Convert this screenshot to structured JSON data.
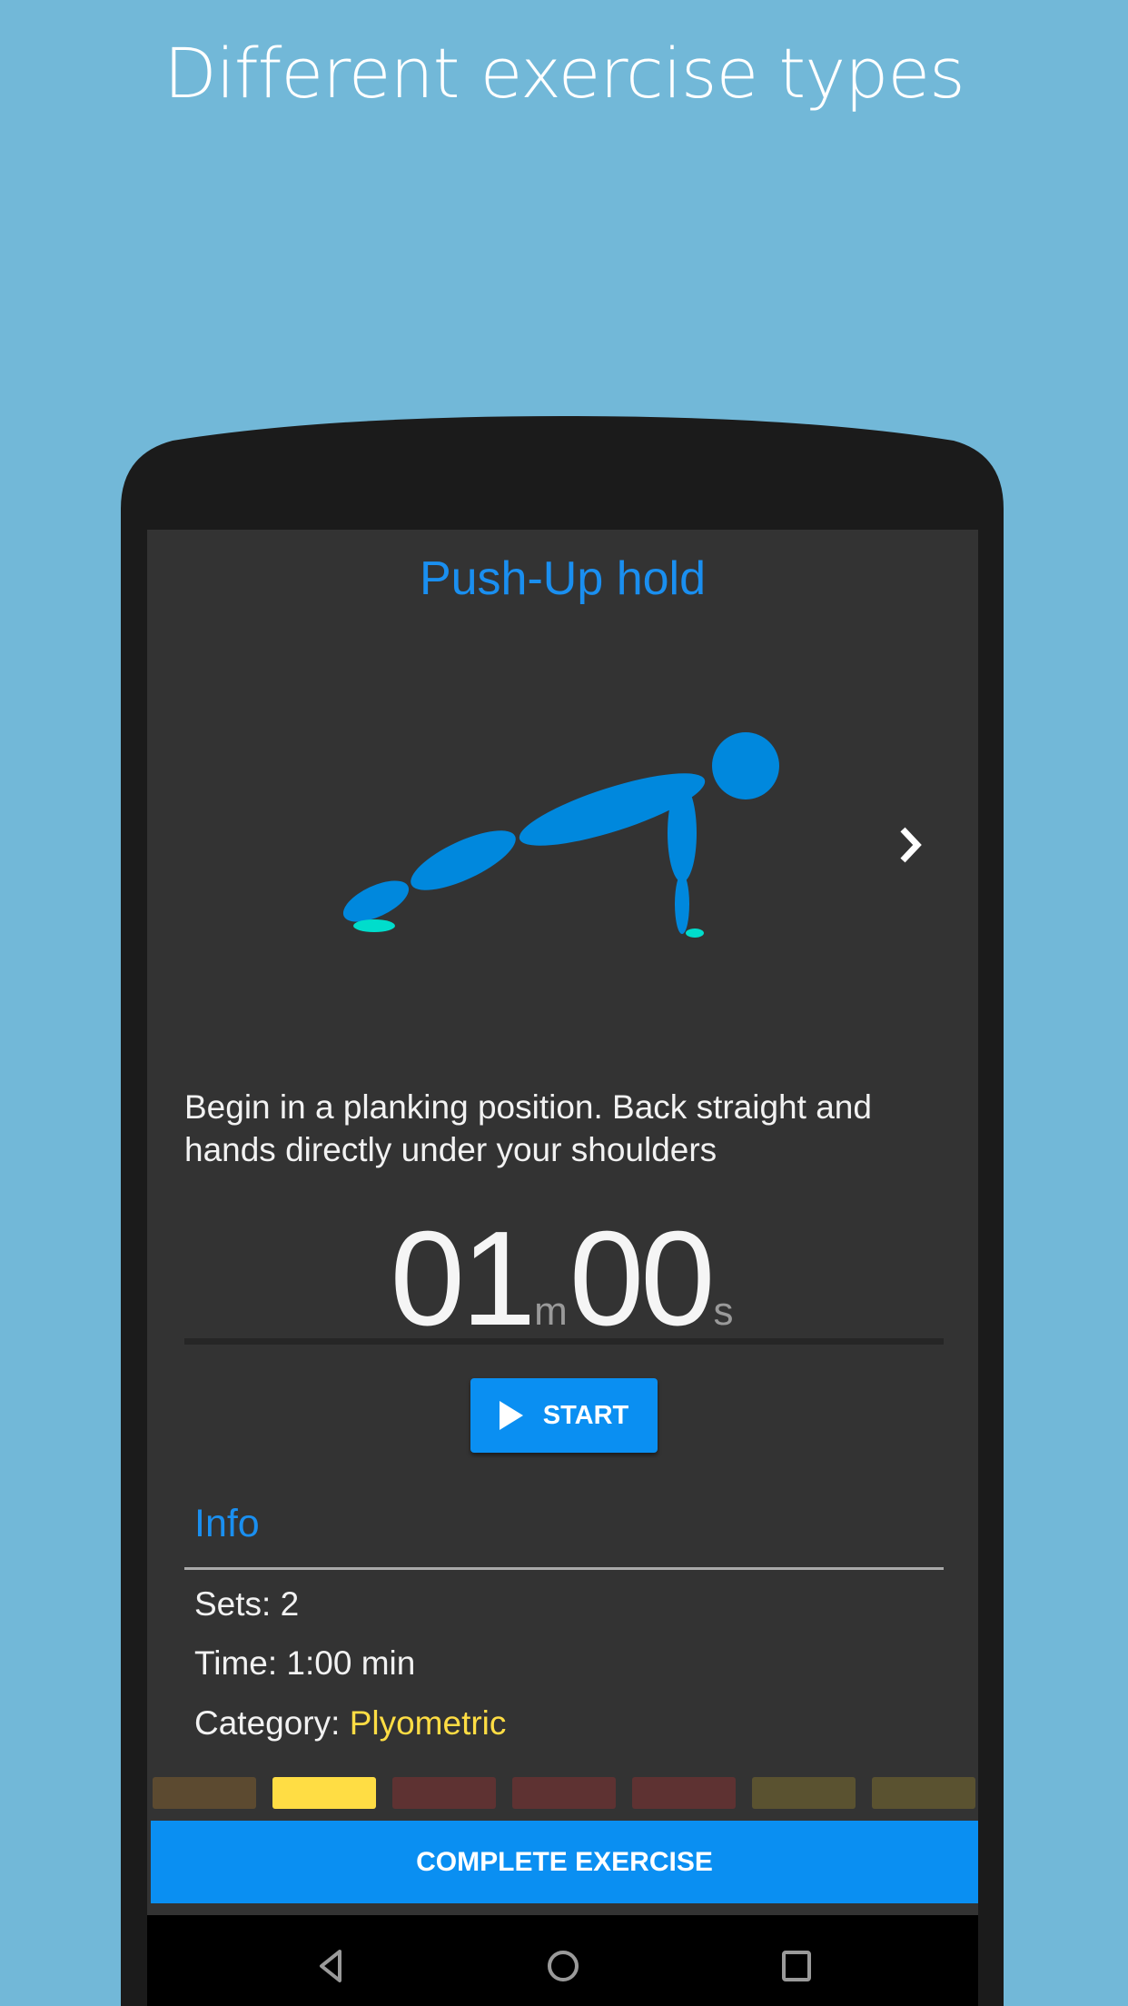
{
  "promo": {
    "title": "Different exercise types"
  },
  "exercise": {
    "title": "Push-Up hold",
    "description": "Begin in a planking position. Back straight and hands directly under your shoulders",
    "timer": {
      "minutes": "01",
      "minutes_unit": "m",
      "seconds": "00",
      "seconds_unit": "s"
    },
    "start_label": "START",
    "next_icon": "chevron-right-icon"
  },
  "info": {
    "heading": "Info",
    "sets_label": "Sets: 2",
    "time_label": "Time: 1:00 min",
    "category_label": "Category: ",
    "category_value": "Plyometric"
  },
  "progress_blocks": [
    {
      "color": "#5c4a30",
      "active": false
    },
    {
      "color": "#ffdd44",
      "active": true
    },
    {
      "color": "#5e3232",
      "active": false
    },
    {
      "color": "#5e3232",
      "active": false
    },
    {
      "color": "#5e3232",
      "active": false
    },
    {
      "color": "#5a5230",
      "active": false
    },
    {
      "color": "#5a5230",
      "active": false
    }
  ],
  "complete_label": "COMPLETE EXERCISE",
  "nav": {
    "icons": [
      "back-icon",
      "home-icon",
      "recents-icon"
    ]
  },
  "colors": {
    "accent": "#0a8ff2",
    "figure_body": "#0088dd",
    "figure_contact": "#00ddcc",
    "category": "#ffdd44"
  }
}
